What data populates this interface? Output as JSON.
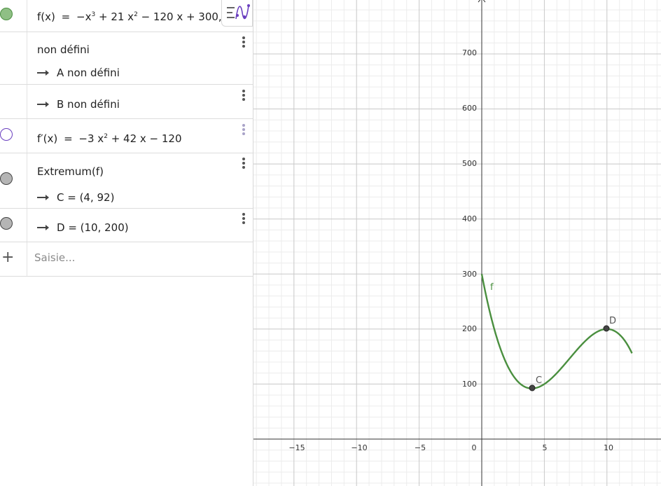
{
  "algebra": {
    "f_def": {
      "name": "f(x)",
      "eq": "=",
      "expr_parts": [
        "−x",
        "3",
        "+ 21 x",
        "2",
        "− 120 x + 300,"
      ]
    },
    "ab_header": "non défini",
    "a_result": "A non défini",
    "b_result": "B non défini",
    "fp_def": {
      "name": "f′(x)",
      "eq": "=",
      "expr_parts": [
        "−3 x",
        "2",
        "+ 42 x − 120"
      ]
    },
    "extremum": "Extremum(f)",
    "c_result": "C = (4, 92)",
    "d_result": "D = (10, 200)",
    "input_placeholder": "Saisie..."
  },
  "colors": {
    "f_curve": "#4a8f3f",
    "f_marble": "#8fbf85",
    "fp_marble": "#6a3fbf",
    "point": "#444444",
    "grid_major": "#c8c8c8",
    "grid_minor": "#ececec"
  },
  "graph": {
    "x_ticks": [
      "−15",
      "−10",
      "−5",
      "0",
      "5",
      "10"
    ],
    "y_ticks": [
      "100",
      "200",
      "300",
      "400",
      "500",
      "600",
      "700"
    ],
    "f_label": "f",
    "point_c_label": "C",
    "point_d_label": "D"
  }
}
